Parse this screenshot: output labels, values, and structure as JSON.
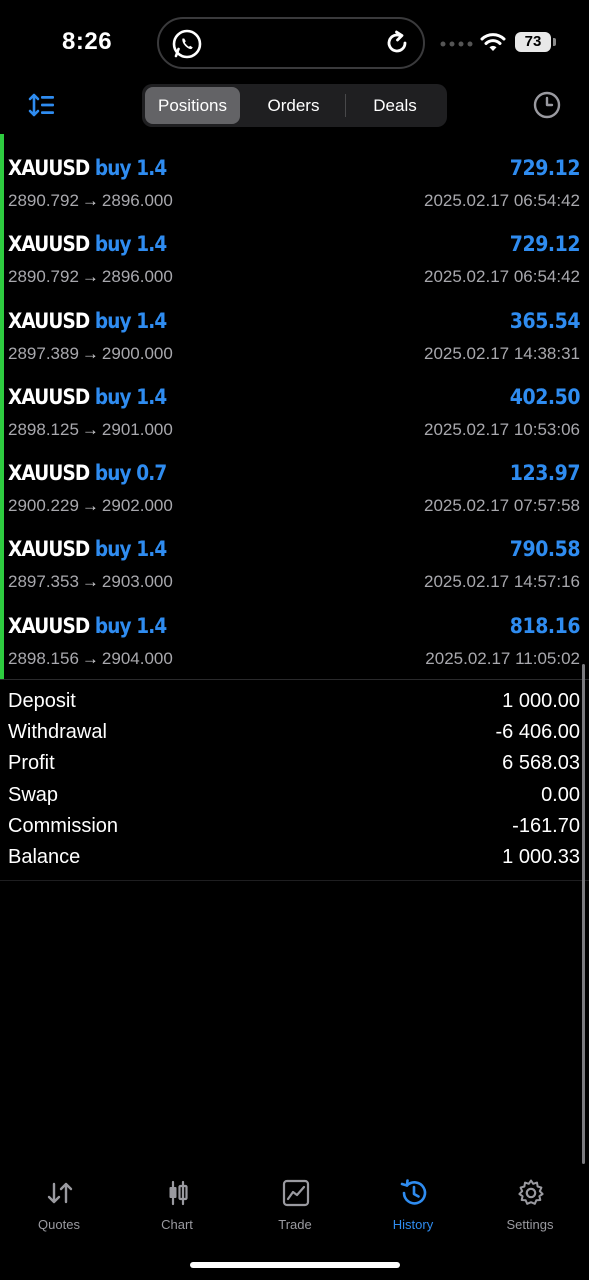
{
  "status_bar": {
    "time": "8:26",
    "battery": "73",
    "icons": [
      "whatsapp-icon",
      "refresh-icon",
      "signal-dots-icon",
      "wifi-icon",
      "battery-icon"
    ]
  },
  "top_nav": {
    "tabs": [
      {
        "label": "Positions",
        "active": true
      },
      {
        "label": "Orders",
        "active": false
      },
      {
        "label": "Deals",
        "active": false
      }
    ],
    "left_icon": "sort-icon",
    "right_icon": "clock-icon",
    "accent_color": "#2f8cf0"
  },
  "positions": [
    {
      "symbol": "XAUUSD",
      "direction": "buy",
      "volume": "1.4",
      "profit": "729.12",
      "open_price": "2890.792",
      "close_price": "2896.000",
      "time": "2025.02.17 06:54:42"
    },
    {
      "symbol": "XAUUSD",
      "direction": "buy",
      "volume": "1.4",
      "profit": "729.12",
      "open_price": "2890.792",
      "close_price": "2896.000",
      "time": "2025.02.17 06:54:42"
    },
    {
      "symbol": "XAUUSD",
      "direction": "buy",
      "volume": "1.4",
      "profit": "365.54",
      "open_price": "2897.389",
      "close_price": "2900.000",
      "time": "2025.02.17 14:38:31"
    },
    {
      "symbol": "XAUUSD",
      "direction": "buy",
      "volume": "1.4",
      "profit": "402.50",
      "open_price": "2898.125",
      "close_price": "2901.000",
      "time": "2025.02.17 10:53:06"
    },
    {
      "symbol": "XAUUSD",
      "direction": "buy",
      "volume": "0.7",
      "profit": "123.97",
      "open_price": "2900.229",
      "close_price": "2902.000",
      "time": "2025.02.17 07:57:58"
    },
    {
      "symbol": "XAUUSD",
      "direction": "buy",
      "volume": "1.4",
      "profit": "790.58",
      "open_price": "2897.353",
      "close_price": "2903.000",
      "time": "2025.02.17 14:57:16"
    },
    {
      "symbol": "XAUUSD",
      "direction": "buy",
      "volume": "1.4",
      "profit": "818.16",
      "open_price": "2898.156",
      "close_price": "2904.000",
      "time": "2025.02.17 11:05:02"
    }
  ],
  "price_arrow": "→",
  "summary": [
    {
      "label": "Deposit",
      "value": "1 000.00"
    },
    {
      "label": "Withdrawal",
      "value": "-6 406.00"
    },
    {
      "label": "Profit",
      "value": "6 568.03"
    },
    {
      "label": "Swap",
      "value": "0.00"
    },
    {
      "label": "Commission",
      "value": "-161.70"
    },
    {
      "label": "Balance",
      "value": "1 000.33"
    }
  ],
  "tab_bar": [
    {
      "label": "Quotes",
      "icon": "quotes-icon",
      "active": false
    },
    {
      "label": "Chart",
      "icon": "chart-icon",
      "active": false
    },
    {
      "label": "Trade",
      "icon": "trade-icon",
      "active": false
    },
    {
      "label": "History",
      "icon": "history-icon",
      "active": true
    },
    {
      "label": "Settings",
      "icon": "settings-icon",
      "active": false
    }
  ]
}
